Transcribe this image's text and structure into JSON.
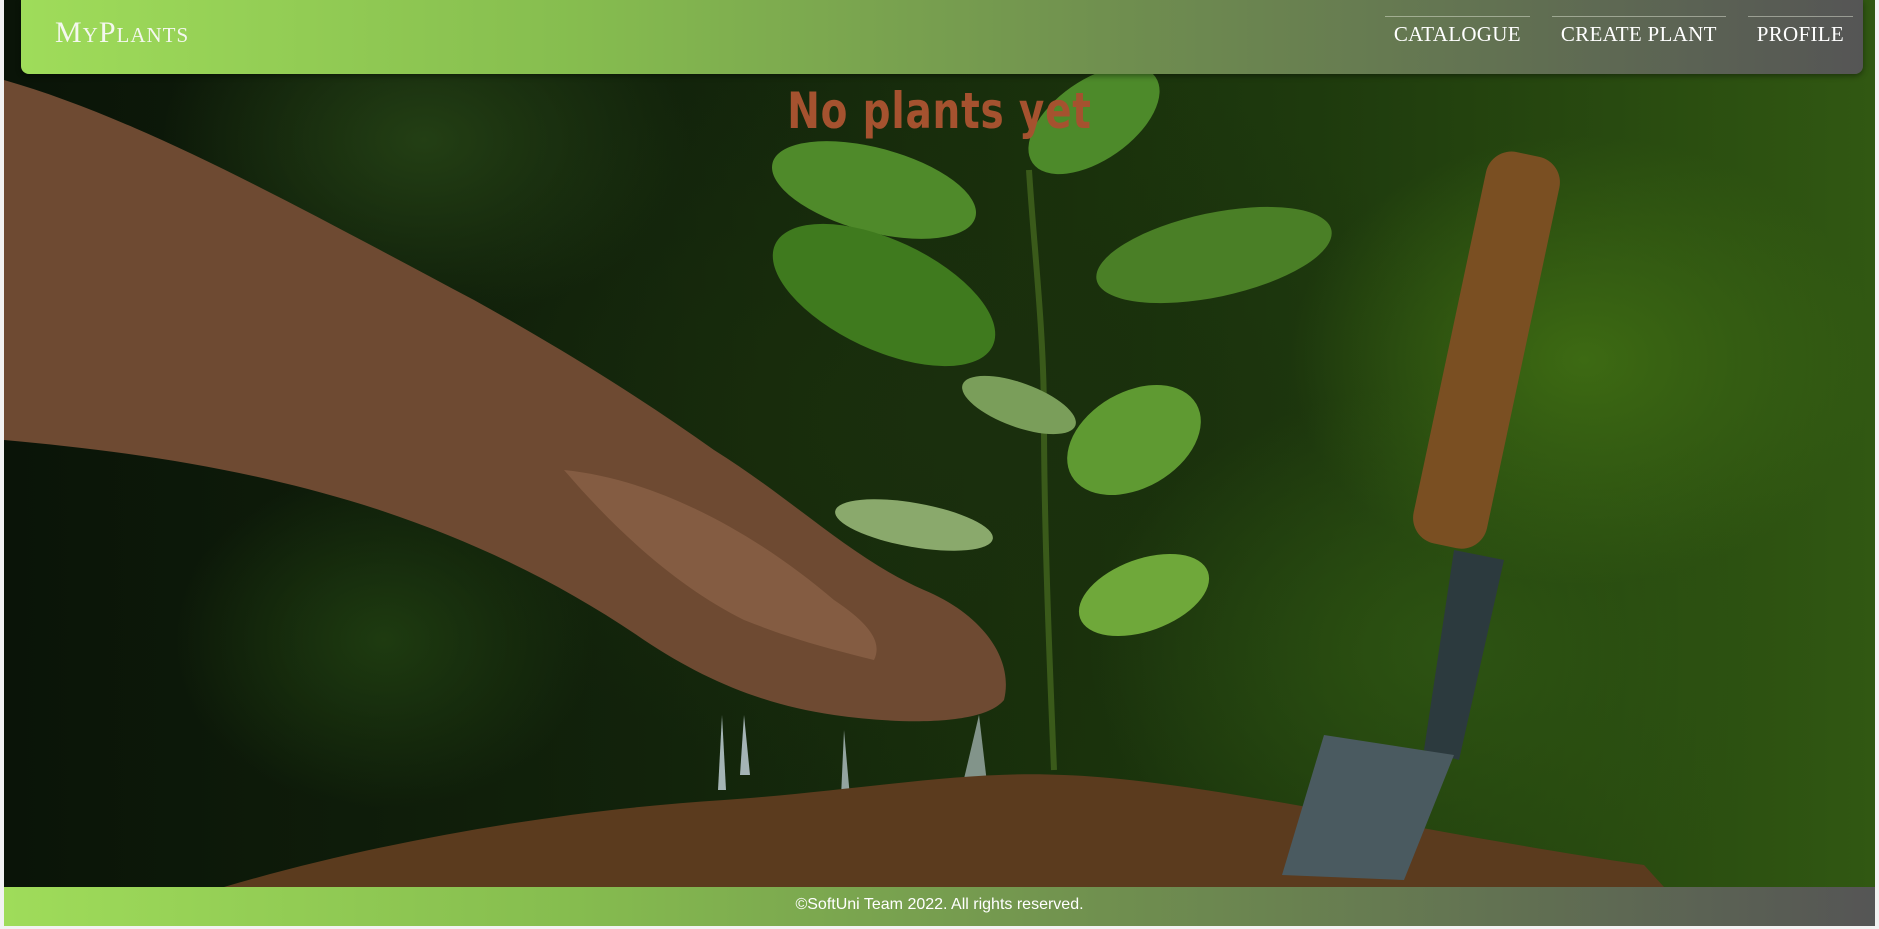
{
  "header": {
    "logo": "MyPlants",
    "nav": [
      {
        "label": "CATALOGUE"
      },
      {
        "label": "CREATE PLANT"
      },
      {
        "label": "PROFILE"
      }
    ]
  },
  "main": {
    "empty_message": "No plants yet",
    "background_image": "hand-watering-seedling-photo"
  },
  "footer": {
    "copyright": "©SoftUni Team 2022. All rights reserved."
  },
  "colors": {
    "header_start": "#9fdc5a",
    "header_end": "#555555",
    "title": "#a5522f",
    "text_light": "#ffffff"
  }
}
